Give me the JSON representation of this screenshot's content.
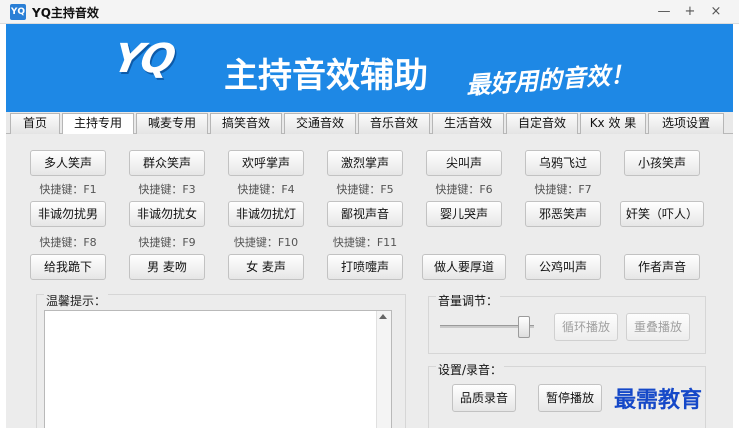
{
  "window": {
    "title": "YQ主持音效",
    "icon_text": "YQ",
    "minimize_glyph": "—",
    "maximize_glyph": "+",
    "close_glyph": "×"
  },
  "banner": {
    "logo": "YQ",
    "main_text": "主持音效辅助",
    "slogan": "最好用的音效！",
    "background_color": "#1e88e5"
  },
  "tabs": [
    "首页",
    "主持专用",
    "喊麦专用",
    "搞笑音效",
    "交通音效",
    "音乐音效",
    "生活音效",
    "自定音效",
    "Kx 效 果",
    "选项设置"
  ],
  "active_tab_index": 1,
  "sound_rows": [
    {
      "buttons": [
        "多人笑声",
        "群众笑声",
        "欢呼掌声",
        "激烈掌声",
        "尖叫声",
        "乌鸦飞过",
        "小孩笑声"
      ],
      "hotkeys": [
        "快捷键：F1",
        "快捷键：F3",
        "快捷键：F4",
        "快捷键：F5",
        "快捷键：F6",
        "快捷键：F7"
      ]
    },
    {
      "buttons": [
        "非诚勿扰男",
        "非诚勿扰女",
        "非诚勿扰灯",
        "鄙视声音",
        "婴儿哭声",
        "邪恶笑声",
        "奸笑（吓人）"
      ],
      "hotkeys": [
        "快捷键：F8",
        "快捷键：F9",
        "快捷键：F10",
        "快捷键：F11"
      ]
    },
    {
      "buttons": [
        "给我跪下",
        "男 麦吻",
        "女 麦声",
        "打喷嚏声",
        "做人要厚道",
        "公鸡叫声",
        "作者声音"
      ],
      "hotkeys": []
    }
  ],
  "tips": {
    "label": "温馨提示：",
    "content": ""
  },
  "volume": {
    "label": "音量调节：",
    "level_fraction": 0.95,
    "loop_button": "循环播放",
    "overlay_button": "重叠播放"
  },
  "recording": {
    "label": "设置/录音：",
    "hq_record_button": "品质录音",
    "pause_button": "暂停播放"
  },
  "watermark": "最需教育"
}
